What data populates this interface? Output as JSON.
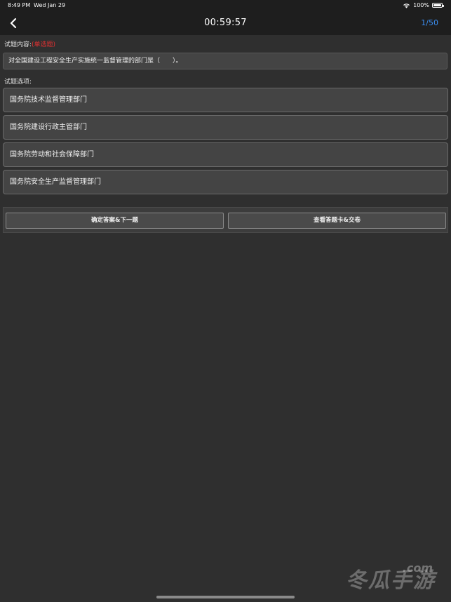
{
  "status_bar": {
    "time": "8:49 PM",
    "date": "Wed Jan 29",
    "battery": "100%"
  },
  "nav": {
    "timer": "00:59:57",
    "progress": "1/50"
  },
  "question": {
    "label": "试题内容:",
    "type": "(单选题)",
    "text": "对全国建设工程安全生产实施统一监督管理的部门是（　　）。"
  },
  "options_label": "试题选项:",
  "options": [
    "国务院技术监督管理部门",
    "国务院建设行政主管部门",
    "国务院劳动和社会保障部门",
    "国务院安全生产监督管理部门"
  ],
  "actions": {
    "confirm_next": "确定答案&下一题",
    "answer_card": "查看答题卡&交卷"
  },
  "watermark": {
    "dotcom": ".com",
    "text": "冬瓜手游"
  },
  "colors": {
    "accent": "#3b8ef0",
    "question_type": "#e03030",
    "background": "#2f2f2f",
    "bar": "#1e1e1e"
  }
}
